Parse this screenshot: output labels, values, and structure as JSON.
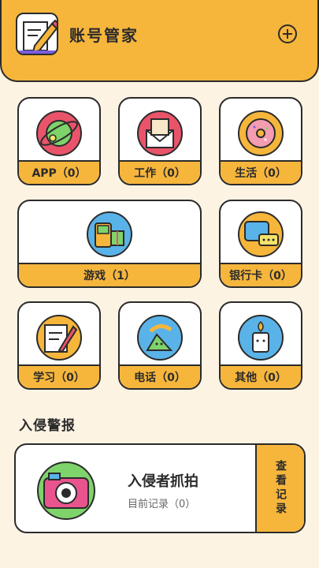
{
  "header": {
    "title": "账号管家",
    "add_icon": "plus-circle-icon",
    "logo_icon": "notebook-pencil-icon"
  },
  "categories": [
    {
      "label": "APP（0）",
      "icon": "planet-icon"
    },
    {
      "label": "工作（0）",
      "icon": "envelope-icon"
    },
    {
      "label": "生活（0）",
      "icon": "donut-icon"
    },
    {
      "label": "游戏（1）",
      "icon": "gameboy-icon"
    },
    {
      "label": "银行卡（0）",
      "icon": "chat-card-icon"
    },
    {
      "label": "学习（0）",
      "icon": "notebook-icon"
    },
    {
      "label": "电话（0）",
      "icon": "telephone-icon"
    },
    {
      "label": "其他（0）",
      "icon": "candle-icon"
    }
  ],
  "intruder": {
    "section_title": "入侵警报",
    "title": "入侵者抓拍",
    "subtitle": "目前记录（0）",
    "view_label": "查看记录",
    "icon": "camera-icon"
  },
  "colors": {
    "accent": "#f6b63c",
    "background": "#fdf3e3",
    "outline": "#2b2b2b"
  }
}
